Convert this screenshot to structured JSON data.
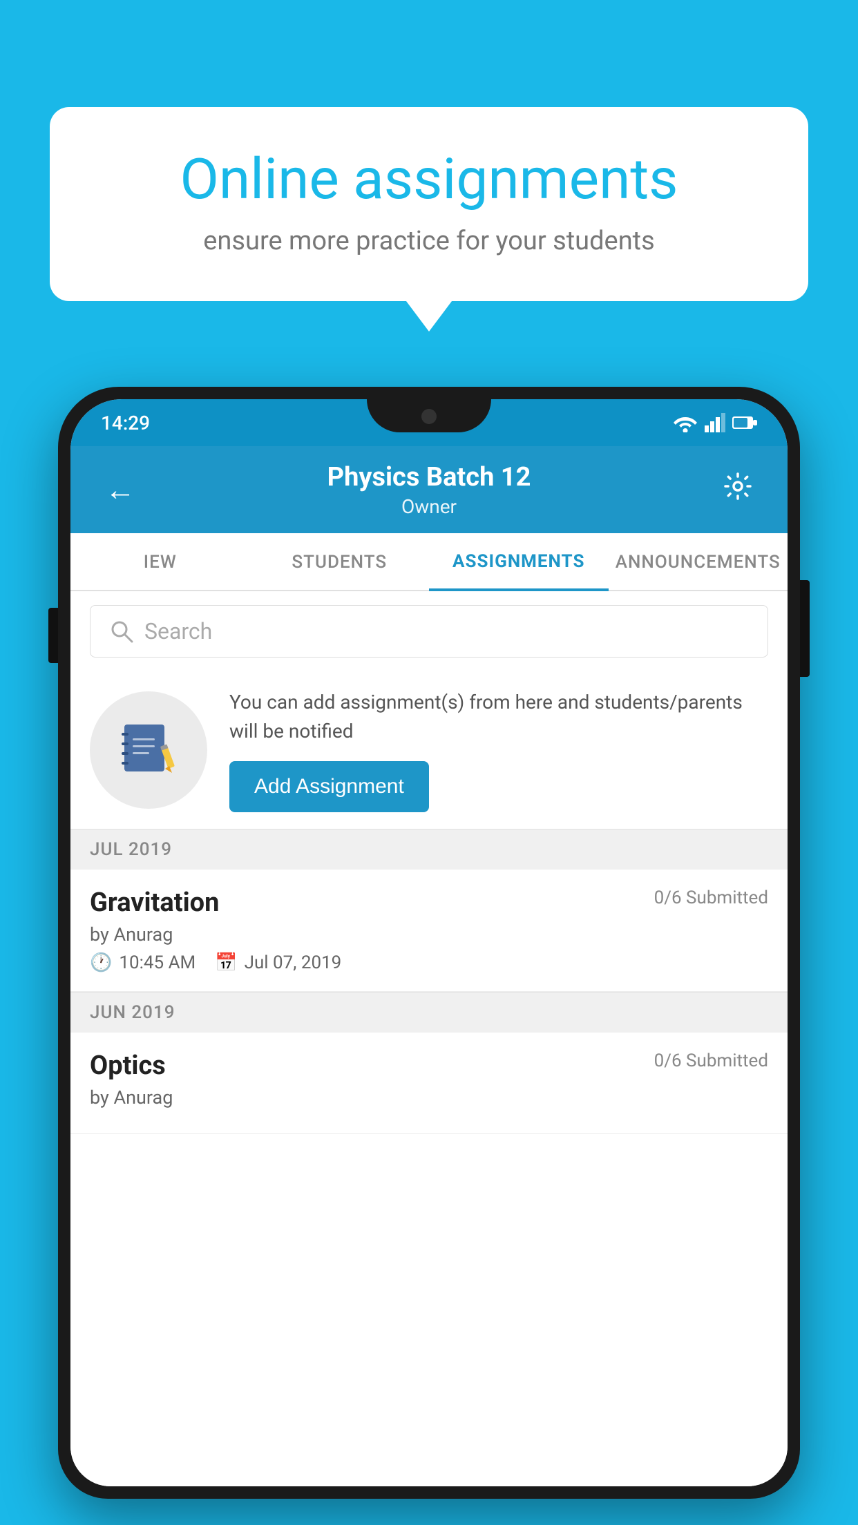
{
  "background_color": "#1ab8e8",
  "speech_bubble": {
    "title": "Online assignments",
    "subtitle": "ensure more practice for your students"
  },
  "phone": {
    "status_bar": {
      "time": "14:29"
    },
    "header": {
      "title": "Physics Batch 12",
      "subtitle": "Owner",
      "back_label": "←",
      "settings_label": "⚙"
    },
    "tabs": [
      {
        "label": "IEW",
        "active": false
      },
      {
        "label": "STUDENTS",
        "active": false
      },
      {
        "label": "ASSIGNMENTS",
        "active": true
      },
      {
        "label": "ANNOUNCEMENTS",
        "active": false
      }
    ],
    "search": {
      "placeholder": "Search"
    },
    "info_section": {
      "description": "You can add assignment(s) from here and students/parents will be notified",
      "add_button_label": "Add Assignment"
    },
    "sections": [
      {
        "month": "JUL 2019",
        "assignments": [
          {
            "name": "Gravitation",
            "submitted": "0/6 Submitted",
            "author": "by Anurag",
            "time": "10:45 AM",
            "date": "Jul 07, 2019"
          }
        ]
      },
      {
        "month": "JUN 2019",
        "assignments": [
          {
            "name": "Optics",
            "submitted": "0/6 Submitted",
            "author": "by Anurag",
            "time": "",
            "date": ""
          }
        ]
      }
    ]
  }
}
